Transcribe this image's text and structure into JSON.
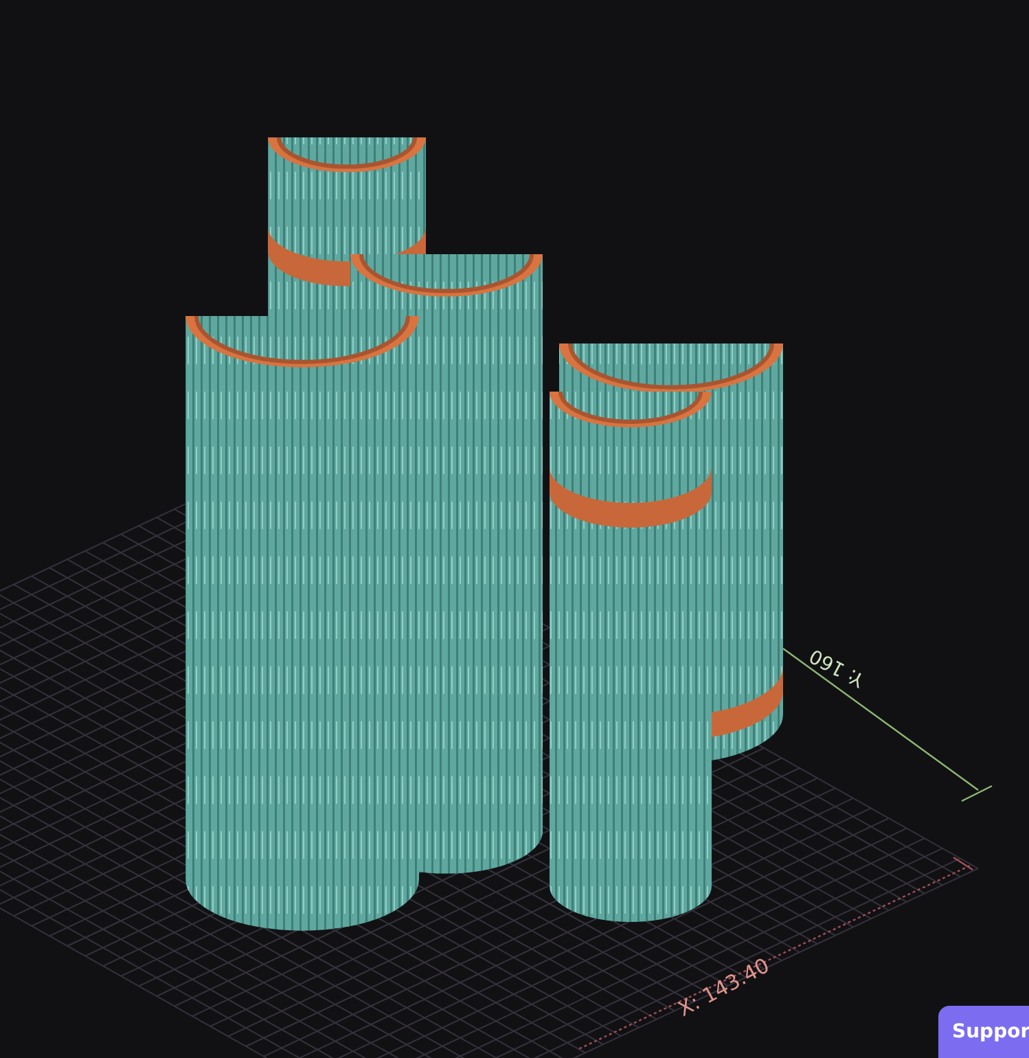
{
  "viewport": {
    "x_axis_label": "X: 143.40",
    "y_axis_label": "Y: 160"
  },
  "support_button": {
    "label": "Suppor"
  }
}
